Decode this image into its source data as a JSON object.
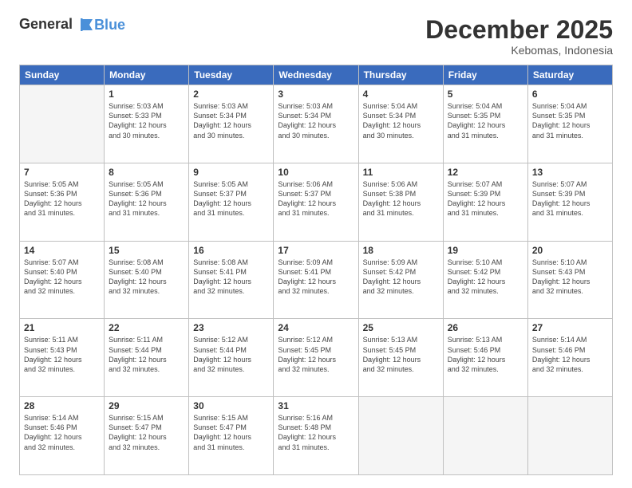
{
  "header": {
    "logo_line1": "General",
    "logo_line2": "Blue",
    "month": "December 2025",
    "location": "Kebomas, Indonesia"
  },
  "weekdays": [
    "Sunday",
    "Monday",
    "Tuesday",
    "Wednesday",
    "Thursday",
    "Friday",
    "Saturday"
  ],
  "weeks": [
    [
      {
        "day": "",
        "info": ""
      },
      {
        "day": "1",
        "info": "Sunrise: 5:03 AM\nSunset: 5:33 PM\nDaylight: 12 hours\nand 30 minutes."
      },
      {
        "day": "2",
        "info": "Sunrise: 5:03 AM\nSunset: 5:34 PM\nDaylight: 12 hours\nand 30 minutes."
      },
      {
        "day": "3",
        "info": "Sunrise: 5:03 AM\nSunset: 5:34 PM\nDaylight: 12 hours\nand 30 minutes."
      },
      {
        "day": "4",
        "info": "Sunrise: 5:04 AM\nSunset: 5:34 PM\nDaylight: 12 hours\nand 30 minutes."
      },
      {
        "day": "5",
        "info": "Sunrise: 5:04 AM\nSunset: 5:35 PM\nDaylight: 12 hours\nand 31 minutes."
      },
      {
        "day": "6",
        "info": "Sunrise: 5:04 AM\nSunset: 5:35 PM\nDaylight: 12 hours\nand 31 minutes."
      }
    ],
    [
      {
        "day": "7",
        "info": "Sunrise: 5:05 AM\nSunset: 5:36 PM\nDaylight: 12 hours\nand 31 minutes."
      },
      {
        "day": "8",
        "info": "Sunrise: 5:05 AM\nSunset: 5:36 PM\nDaylight: 12 hours\nand 31 minutes."
      },
      {
        "day": "9",
        "info": "Sunrise: 5:05 AM\nSunset: 5:37 PM\nDaylight: 12 hours\nand 31 minutes."
      },
      {
        "day": "10",
        "info": "Sunrise: 5:06 AM\nSunset: 5:37 PM\nDaylight: 12 hours\nand 31 minutes."
      },
      {
        "day": "11",
        "info": "Sunrise: 5:06 AM\nSunset: 5:38 PM\nDaylight: 12 hours\nand 31 minutes."
      },
      {
        "day": "12",
        "info": "Sunrise: 5:07 AM\nSunset: 5:39 PM\nDaylight: 12 hours\nand 31 minutes."
      },
      {
        "day": "13",
        "info": "Sunrise: 5:07 AM\nSunset: 5:39 PM\nDaylight: 12 hours\nand 31 minutes."
      }
    ],
    [
      {
        "day": "14",
        "info": "Sunrise: 5:07 AM\nSunset: 5:40 PM\nDaylight: 12 hours\nand 32 minutes."
      },
      {
        "day": "15",
        "info": "Sunrise: 5:08 AM\nSunset: 5:40 PM\nDaylight: 12 hours\nand 32 minutes."
      },
      {
        "day": "16",
        "info": "Sunrise: 5:08 AM\nSunset: 5:41 PM\nDaylight: 12 hours\nand 32 minutes."
      },
      {
        "day": "17",
        "info": "Sunrise: 5:09 AM\nSunset: 5:41 PM\nDaylight: 12 hours\nand 32 minutes."
      },
      {
        "day": "18",
        "info": "Sunrise: 5:09 AM\nSunset: 5:42 PM\nDaylight: 12 hours\nand 32 minutes."
      },
      {
        "day": "19",
        "info": "Sunrise: 5:10 AM\nSunset: 5:42 PM\nDaylight: 12 hours\nand 32 minutes."
      },
      {
        "day": "20",
        "info": "Sunrise: 5:10 AM\nSunset: 5:43 PM\nDaylight: 12 hours\nand 32 minutes."
      }
    ],
    [
      {
        "day": "21",
        "info": "Sunrise: 5:11 AM\nSunset: 5:43 PM\nDaylight: 12 hours\nand 32 minutes."
      },
      {
        "day": "22",
        "info": "Sunrise: 5:11 AM\nSunset: 5:44 PM\nDaylight: 12 hours\nand 32 minutes."
      },
      {
        "day": "23",
        "info": "Sunrise: 5:12 AM\nSunset: 5:44 PM\nDaylight: 12 hours\nand 32 minutes."
      },
      {
        "day": "24",
        "info": "Sunrise: 5:12 AM\nSunset: 5:45 PM\nDaylight: 12 hours\nand 32 minutes."
      },
      {
        "day": "25",
        "info": "Sunrise: 5:13 AM\nSunset: 5:45 PM\nDaylight: 12 hours\nand 32 minutes."
      },
      {
        "day": "26",
        "info": "Sunrise: 5:13 AM\nSunset: 5:46 PM\nDaylight: 12 hours\nand 32 minutes."
      },
      {
        "day": "27",
        "info": "Sunrise: 5:14 AM\nSunset: 5:46 PM\nDaylight: 12 hours\nand 32 minutes."
      }
    ],
    [
      {
        "day": "28",
        "info": "Sunrise: 5:14 AM\nSunset: 5:46 PM\nDaylight: 12 hours\nand 32 minutes."
      },
      {
        "day": "29",
        "info": "Sunrise: 5:15 AM\nSunset: 5:47 PM\nDaylight: 12 hours\nand 32 minutes."
      },
      {
        "day": "30",
        "info": "Sunrise: 5:15 AM\nSunset: 5:47 PM\nDaylight: 12 hours\nand 31 minutes."
      },
      {
        "day": "31",
        "info": "Sunrise: 5:16 AM\nSunset: 5:48 PM\nDaylight: 12 hours\nand 31 minutes."
      },
      {
        "day": "",
        "info": ""
      },
      {
        "day": "",
        "info": ""
      },
      {
        "day": "",
        "info": ""
      }
    ]
  ]
}
